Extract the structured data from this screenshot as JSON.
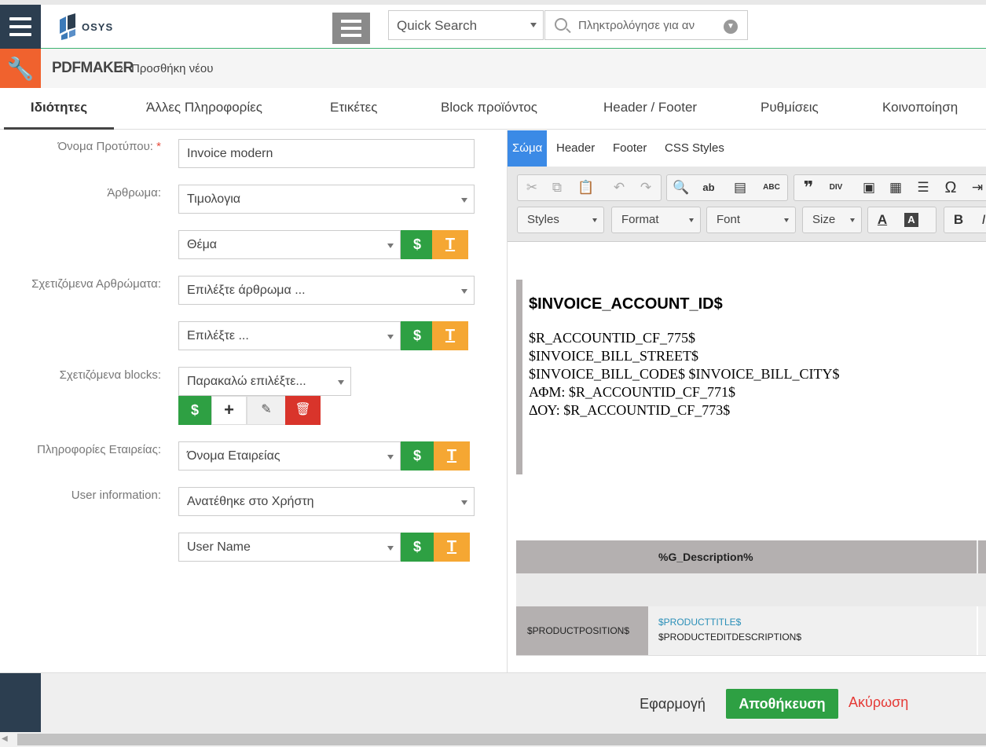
{
  "header": {
    "logo_text": "OSYS",
    "quick_search_label": "Quick Search",
    "search_placeholder": "Πληκτρολόγησε για αν"
  },
  "breadcrumb": {
    "module": "PDFMAKER",
    "separator": "›",
    "page": "Προσθήκη νέου"
  },
  "tabs": [
    {
      "label": "Ιδιότητες",
      "active": true
    },
    {
      "label": "Άλλες Πληροφορίες"
    },
    {
      "label": "Ετικέτες"
    },
    {
      "label": "Block προϊόντος"
    },
    {
      "label": "Header / Footer"
    },
    {
      "label": "Ρυθμίσεις"
    },
    {
      "label": "Κοινοποίηση"
    }
  ],
  "form": {
    "template_name_label": "Όνομα Προτύπου:",
    "required_marker": "*",
    "template_name_value": "Invoice modern",
    "module_label": "Άρθρωμα:",
    "module_value": "Τιμολογια",
    "subject_value": "Θέμα",
    "related_modules_label": "Σχετιζόμενα Αρθρώματα:",
    "related_module_value": "Επιλέξτε άρθρωμα ...",
    "related_field_value": "Επιλέξτε ...",
    "related_blocks_label": "Σχετιζόμενα blocks:",
    "related_blocks_value": "Παρακαλώ επιλέξτε...",
    "company_info_label": "Πληροφορίες Εταιρείας:",
    "company_info_value": "Όνομα Εταιρείας",
    "user_info_label": "User information:",
    "user_info_value": "Ανατέθηκε στο Χρήστη",
    "user_name_value": "User Name",
    "dollar_label": "$",
    "t_label": "T",
    "plus_label": "+",
    "edit_icon": "✎",
    "delete_icon": "🗑"
  },
  "editor": {
    "tabs": [
      {
        "label": "Σώμα",
        "active": true
      },
      {
        "label": "Header"
      },
      {
        "label": "Footer"
      },
      {
        "label": "CSS Styles"
      }
    ],
    "combos": {
      "styles": "Styles",
      "format": "Format",
      "font": "Font",
      "size": "Size"
    },
    "toolbar_glyphs": {
      "cut": "✂",
      "copy": "⧉",
      "paste": "📋",
      "undo": "↶",
      "redo": "↷",
      "find": "🔍",
      "replace": "ab",
      "select_all": "▤",
      "spellcheck": "ABC",
      "blockquote": "❞",
      "div": "DIV",
      "image": "▣",
      "table": "▦",
      "hr": "☰",
      "special_char": "Ω",
      "indent": "⇥",
      "text_color": "A",
      "bg_color": "A",
      "bold": "B",
      "italic": "I"
    },
    "content": {
      "heading": "$INVOICE_ACCOUNT_ID$",
      "lines": [
        "$R_ACCOUNTID_CF_775$",
        "$INVOICE_BILL_STREET$",
        "$INVOICE_BILL_CODE$ $INVOICE_BILL_CITY$",
        "ΑΦΜ: $R_ACCOUNTID_CF_771$",
        "ΔΟΥ: $R_ACCOUNTID_CF_773$"
      ],
      "table_header_desc": "%G_Description%",
      "row_position": "$PRODUCTPOSITION$",
      "row_title": "$PRODUCTTITLE$",
      "row_description": "$PRODUCTEDITDESCRIPTION$"
    }
  },
  "footer": {
    "apply_label": "Εφαρμογή",
    "save_label": "Αποθήκευση",
    "cancel_label": "Ακύρωση"
  },
  "colors": {
    "brand_dark": "#2c3e50",
    "accent_orange": "#f0622e",
    "green": "#2ea043",
    "orange_btn": "#f5a733",
    "red": "#d9342b",
    "editor_tab_active": "#3b8ae6"
  }
}
